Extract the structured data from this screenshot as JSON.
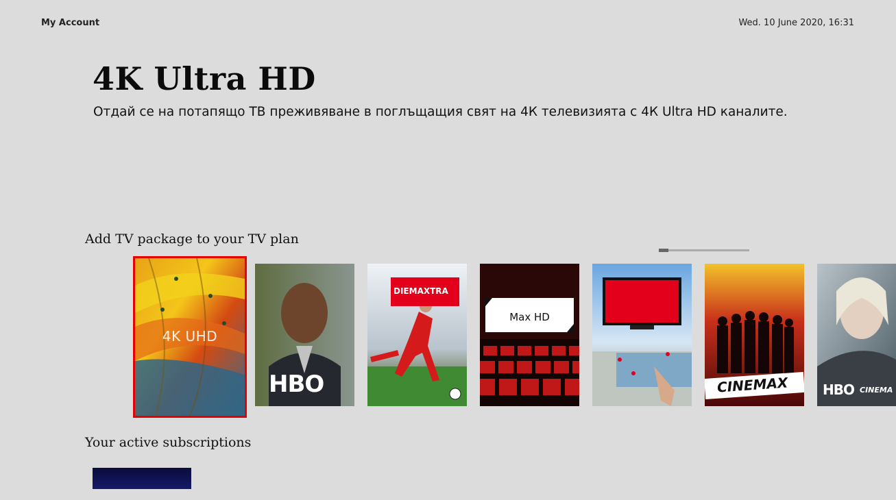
{
  "header": {
    "account_label": "My Account",
    "datetime": "Wed. 10 June 2020, 16:31"
  },
  "hero": {
    "title": "4K Ultra HD",
    "description": "Отдай се на потапящо ТВ преживяване в поглъщащия свят на 4К телевизията с 4К Ultra HD каналите."
  },
  "packages": {
    "section_title": "Add TV package to your TV plan",
    "selected_index": 0,
    "items": [
      {
        "label": "4K UHD",
        "icon": "feathers-image"
      },
      {
        "label": "HBO",
        "icon": "man-portrait-image"
      },
      {
        "label": "DIEMAXTRA",
        "icon": "football-player-image"
      },
      {
        "label": "Max HD",
        "icon": "cinema-seats-image"
      },
      {
        "label": "",
        "icon": "tv-screens-image"
      },
      {
        "label": "CINEMAX",
        "icon": "group-of-men-image"
      },
      {
        "label": "HBO",
        "label2": "CINEMA",
        "icon": "woman-portrait-image"
      }
    ]
  },
  "subscriptions": {
    "section_title": "Your active subscriptions"
  },
  "colors": {
    "background": "#dcdcdc",
    "focus_border": "#e60000",
    "brand_red": "#e2001a"
  }
}
